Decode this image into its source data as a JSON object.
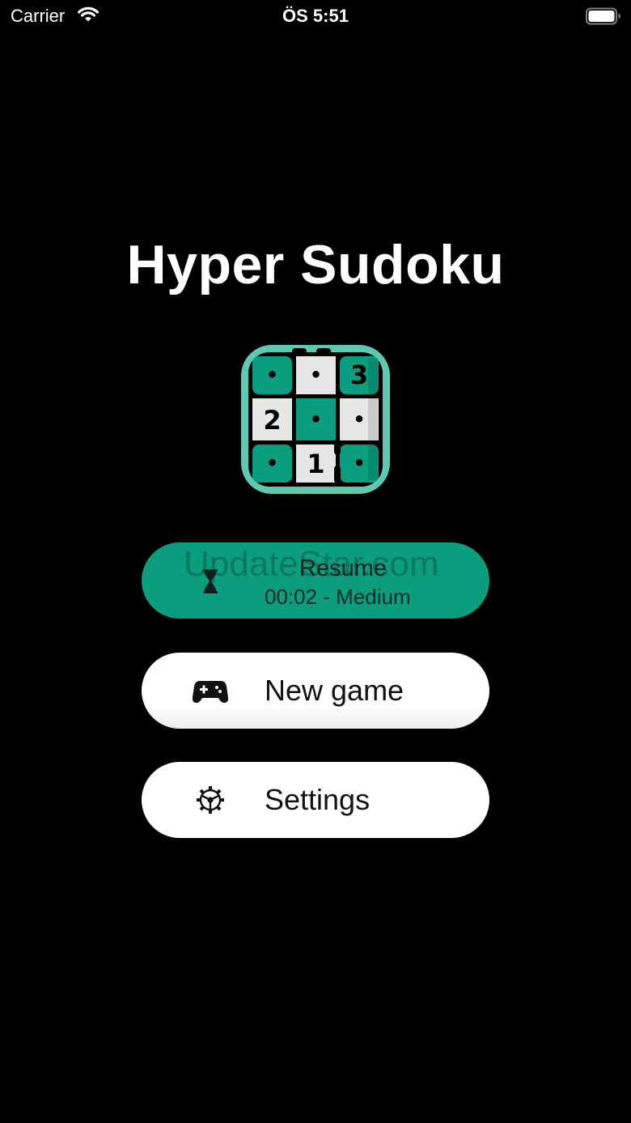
{
  "status_bar": {
    "carrier": "Carrier",
    "time": "ÖS 5:51",
    "wifi_icon": "wifi-icon",
    "battery_icon": "battery-full-icon"
  },
  "app": {
    "title": "Hyper Sudoku"
  },
  "logo": {
    "icon": "sudoku-grid-logo",
    "cells": [
      "•",
      "•",
      "3",
      "2",
      "•",
      "•",
      "•",
      "1",
      "•"
    ],
    "colors": {
      "teal": "#0a9e7f",
      "light_teal": "#5cc9b1",
      "light_cell": "#e6e6e6",
      "dark": "#000000"
    }
  },
  "menu": {
    "resume": {
      "label": "Resume",
      "detail": "00:02 - Medium",
      "icon": "hourglass-icon",
      "background": "#0a9e7f"
    },
    "new_game": {
      "label": "New game",
      "icon": "gamepad-icon",
      "background": "#ffffff"
    },
    "settings": {
      "label": "Settings",
      "icon": "gear-icon",
      "background": "#ffffff"
    }
  },
  "watermark": {
    "text": "UpdateStar.com"
  }
}
